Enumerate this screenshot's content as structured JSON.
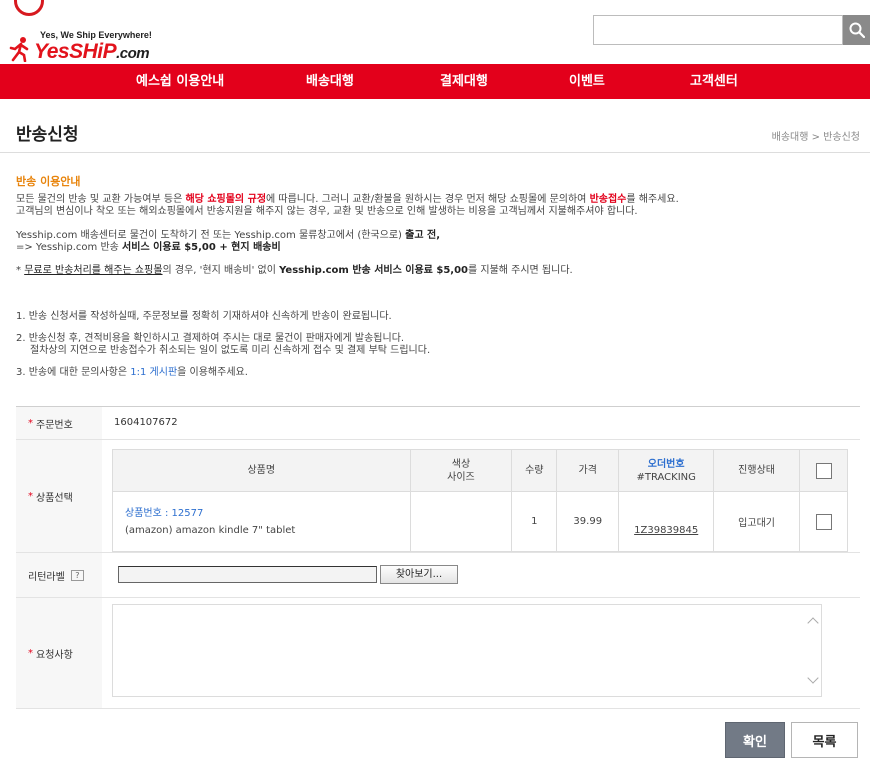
{
  "header": {
    "tagline": "Yes, We Ship Everywhere!",
    "logo_main": "YesSHiP",
    "logo_suffix": ".com",
    "search_placeholder": ""
  },
  "nav": [
    "예스쉽 이용안내",
    "배송대행",
    "결제대행",
    "이벤트",
    "고객센터"
  ],
  "page": {
    "title": "반송신청",
    "breadcrumb": "배송대행 > 반송신청"
  },
  "info": {
    "heading": "반송 이용안내",
    "p1a": "모든 물건의 반송 및 교환 가능여부 등은 ",
    "p1b": "해당 쇼핑몰의 규정",
    "p1c": "에 따릅니다. 그러니 교환/환불을 원하시는 경우 먼저 해당 쇼핑몰에 문의하여 ",
    "p1d": "반송접수",
    "p1e": "를 해주세요.",
    "p2": "고객님의 변심이나 착오 또는 해외쇼핑몰에서 반송지원을 해주지 않는 경우, 교환 및 반송으로 인해 발생하는 비용을 고객님께서 지불해주셔야 합니다.",
    "p3a": "Yesship.com 배송센터로 물건이 도착하기 전 또는 Yesship.com 물류창고에서 (한국으로) ",
    "p3b": "출고 전,",
    "p4a": "=> Yesship.com 반송 ",
    "p4b": "서비스 이용료 $5,00 + 현지 배송비",
    "p5a": "* ",
    "p5b": "무료로 반송처리를 해주는 쇼핑몰",
    "p5c": "의 경우, '현지 배송비' 없이 ",
    "p5d": "Yesship.com 반송 서비스 이용료 $5,00",
    "p5e": "를 지불해 주시면 됩니다.",
    "n1": "1. 반송 신청서를 작성하실때, 주문정보를 정확히 기재하셔야 신속하게 반송이 완료됩니다.",
    "n2a": "2. 반송신청 후, 견적비용을 확인하시고 결제하여 주시는 대로 물건이 판매자에게 발송됩니다.",
    "n2b": "절차상의 지연으로 반송접수가 취소되는 일이 없도록 미리 신속하게 접수 및 결제 부탁 드립니다.",
    "n3a": "3. 반송에 대한 문의사항은 ",
    "n3b": "1:1 게시판",
    "n3c": "을 이용해주세요."
  },
  "form": {
    "order_label": "주문번호",
    "order_value": "1604107672",
    "item_label": "상품선택",
    "columns": {
      "name": "상품명",
      "color_a": "색상",
      "color_b": "사이즈",
      "qty": "수량",
      "price": "가격",
      "order_a": "오더번호",
      "order_b": "#TRACKING",
      "status": "진행상태"
    },
    "item": {
      "code": "상품번호 : 12577",
      "name": "(amazon) amazon kindle 7\" tablet",
      "color_size": "",
      "qty": "1",
      "price": "39.99",
      "tracking": "1Z39839845",
      "status": "입고대기"
    },
    "return_label": "리턴라벨",
    "help": "?",
    "browse": "찾아보기...",
    "request_label": "요청사항",
    "request_value": ""
  },
  "buttons": {
    "confirm": "확인",
    "list": "목록"
  },
  "colors": {
    "brand_red": "#e3001b",
    "accent_orange": "#e8840c",
    "link_blue": "#2d6fcf"
  }
}
